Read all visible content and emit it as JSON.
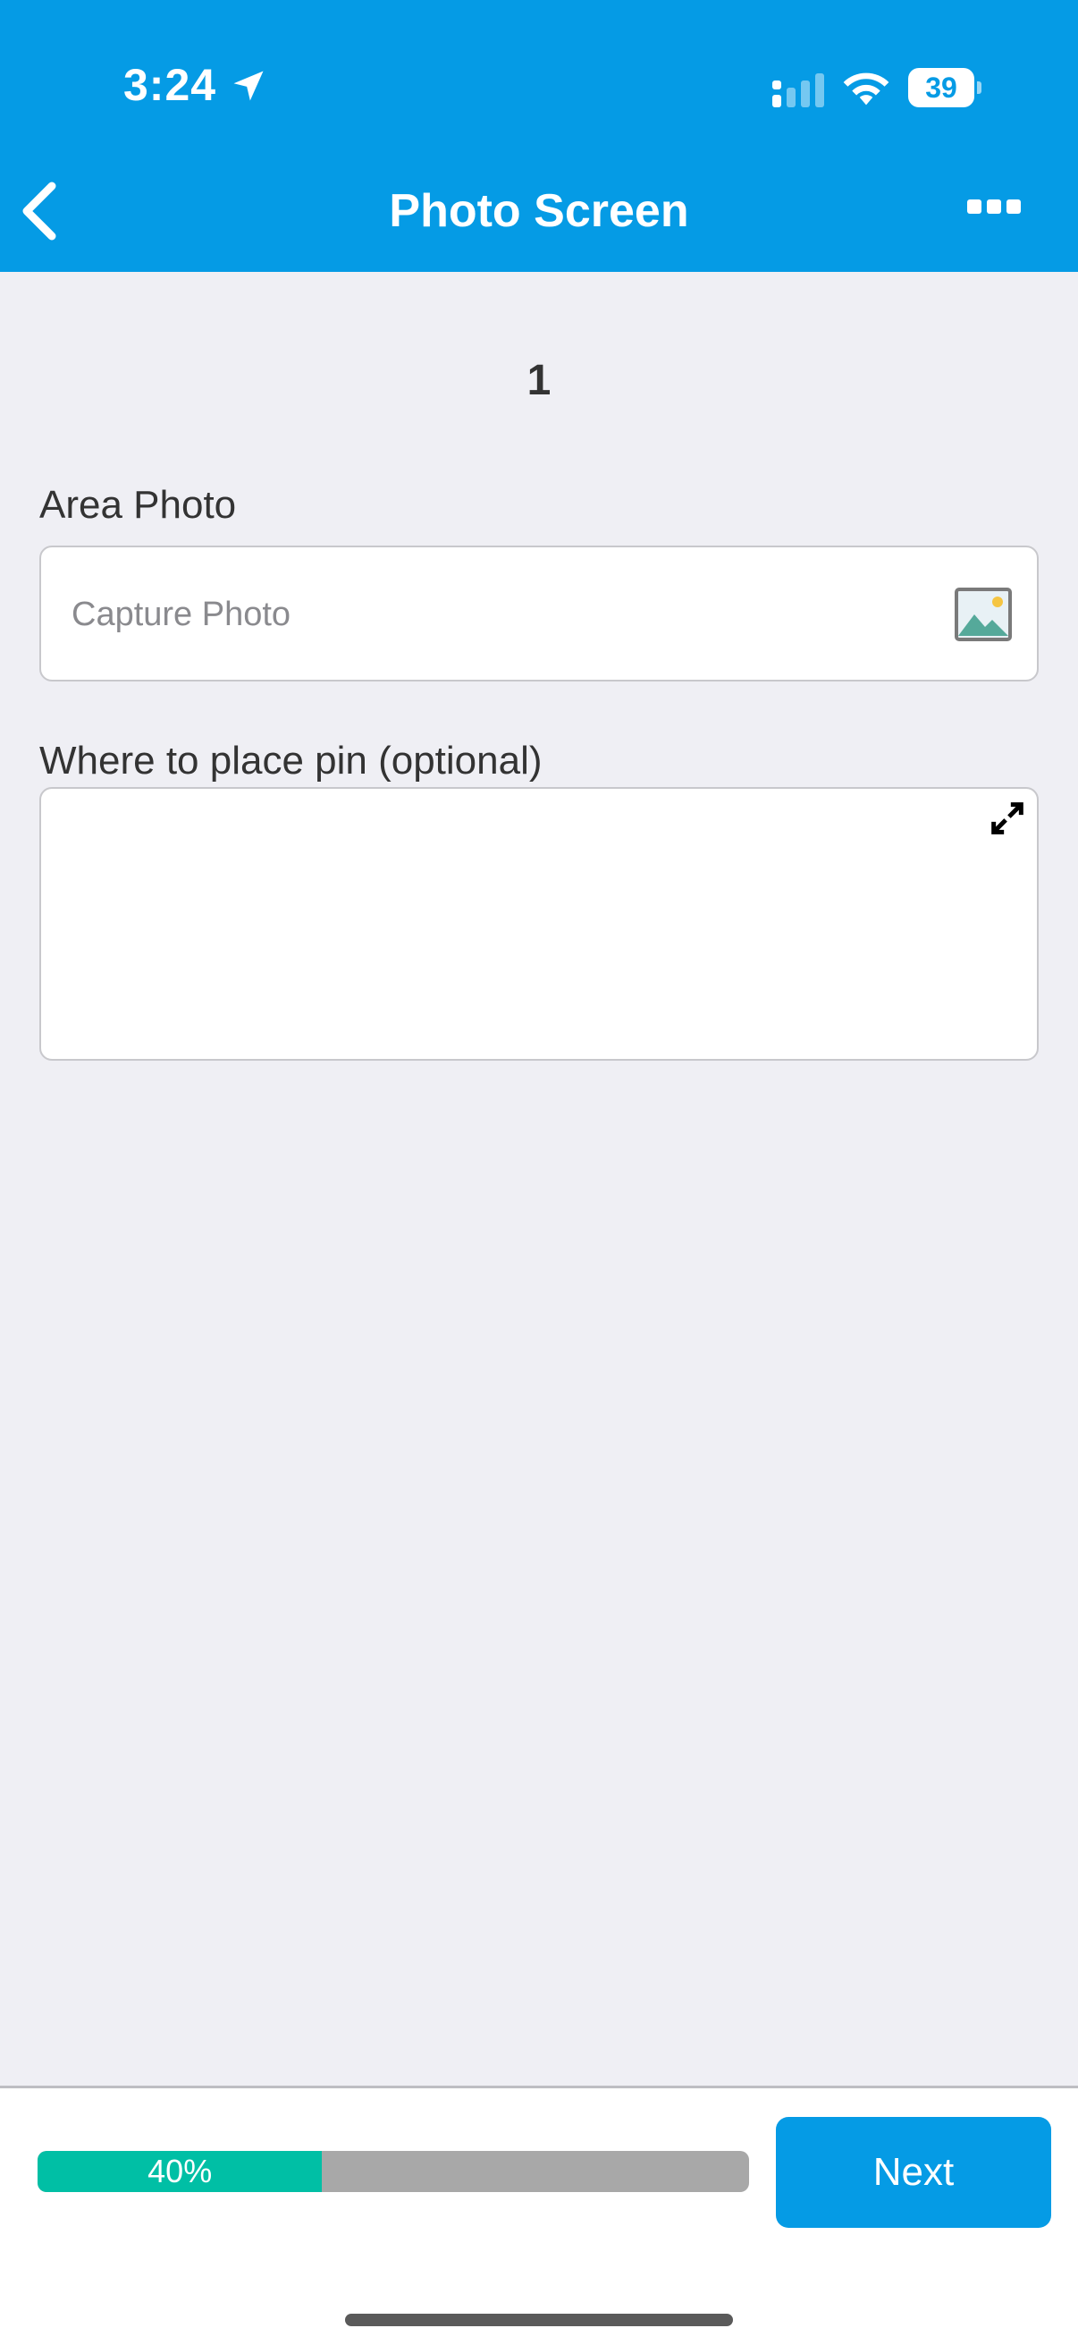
{
  "status_bar": {
    "time": "3:24",
    "battery_level": "39"
  },
  "nav": {
    "title": "Photo Screen"
  },
  "content": {
    "page_number": "1",
    "area_photo": {
      "label": "Area Photo",
      "placeholder": "Capture Photo"
    },
    "pin": {
      "label": "Where to place pin (optional)"
    }
  },
  "footer": {
    "progress_fraction": 0.4,
    "progress_label": "40%",
    "next_label": "Next"
  },
  "colors": {
    "brand": "#059BE5",
    "progress_fill": "#00BFA5",
    "progress_track": "#A8A8A8",
    "background": "#EFEFF4"
  },
  "icons": {
    "back": "chevron-left-icon",
    "more": "ellipsis-icon",
    "location": "location-arrow-icon",
    "signal": "cellular-signal-icon",
    "wifi": "wifi-icon",
    "image": "image-icon",
    "expand": "expand-icon"
  }
}
